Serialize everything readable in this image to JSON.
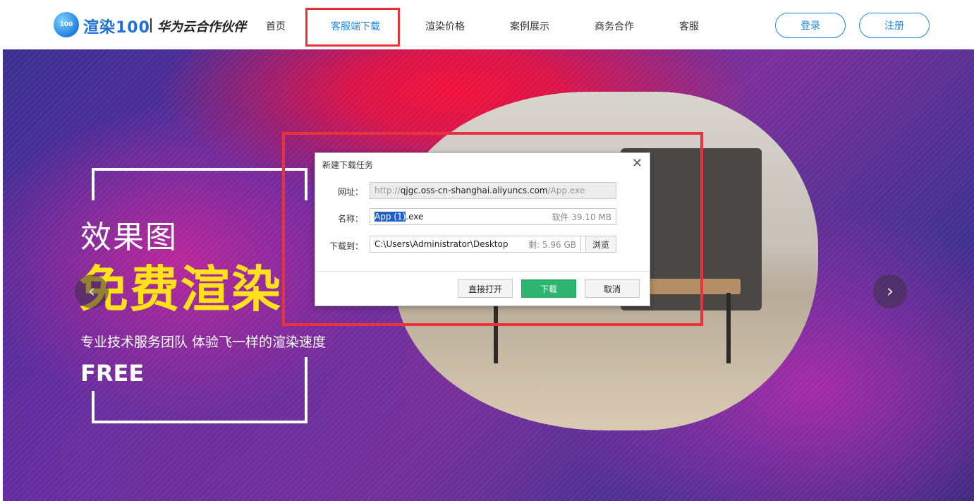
{
  "header": {
    "logo_text": "100",
    "brand": "渲染100",
    "partner": "华为云合作伙伴",
    "nav": [
      {
        "label": "首页"
      },
      {
        "label": "客服端下载",
        "active": true
      },
      {
        "label": "渲染价格"
      },
      {
        "label": "案例展示"
      },
      {
        "label": "商务合作"
      },
      {
        "label": "客服"
      }
    ],
    "login_label": "登录",
    "register_label": "注册"
  },
  "banner": {
    "line1": "效果图",
    "line2": "免费渲染",
    "line3": "专业技术服务团队 体验飞一样的渲染速度",
    "line4": "FREE",
    "prev_arrow": "‹",
    "next_arrow": "›"
  },
  "dialog": {
    "title": "新建下载任务",
    "close": "✕",
    "url_label": "网址：",
    "url_prefix": "http://",
    "url_host": "qjgc.oss-cn-shanghai.aliyuncs.com",
    "url_path": "/App.exe",
    "name_label": "名称：",
    "name_selected": "App (1)",
    "name_ext": ".exe",
    "name_info": "软件 39.10 MB",
    "path_label": "下载到：",
    "path_value": "C:\\Users\\Administrator\\Desktop",
    "path_space": "剩: 5.96 GB",
    "dropdown_icon": "▼",
    "browse_label": "浏览",
    "open_label": "直接打开",
    "download_label": "下载",
    "cancel_label": "取消"
  },
  "colors": {
    "accent": "#1e88e5",
    "highlight": "#e8333b",
    "download_button": "#2db56f",
    "title_yellow": "#ffe21a"
  }
}
